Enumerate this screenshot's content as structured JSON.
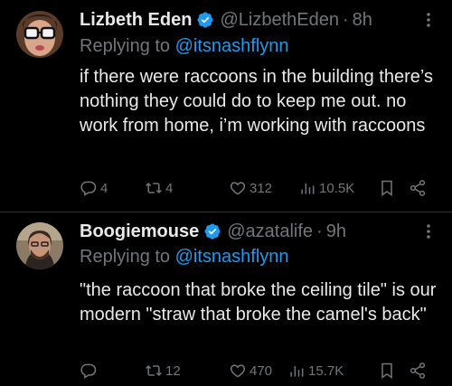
{
  "tweets": [
    {
      "name": "Lizbeth Eden",
      "handle": "@LizbethEden",
      "separator": "·",
      "time": "8h",
      "replying_prefix": "Replying to",
      "replying_to": "@itsnashflynn",
      "text": "if there were raccoons in the building there’s nothing they could do to keep me out. no work from home, i’m working with raccoons",
      "replies": "4",
      "retweets": "4",
      "likes": "312",
      "views": "10.5K"
    },
    {
      "name": "Boogiemouse",
      "handle": "@azatalife",
      "separator": "·",
      "time": "9h",
      "replying_prefix": "Replying to",
      "replying_to": "@itsnashflynn",
      "text": "\"the raccoon that broke the ceiling tile\" is our modern \"straw that broke the camel's back\"",
      "replies": "",
      "retweets": "12",
      "likes": "470",
      "views": "15.7K"
    }
  ],
  "colors": {
    "background": "#000000",
    "text": "#e7e9ea",
    "secondary": "#71767b",
    "link": "#1d9bf0",
    "verified": "#1d9bf0",
    "divider": "#2f3336"
  },
  "icons": [
    "verified-badge-icon",
    "more-icon",
    "reply-icon",
    "retweet-icon",
    "like-icon",
    "views-icon",
    "bookmark-icon",
    "share-icon"
  ]
}
